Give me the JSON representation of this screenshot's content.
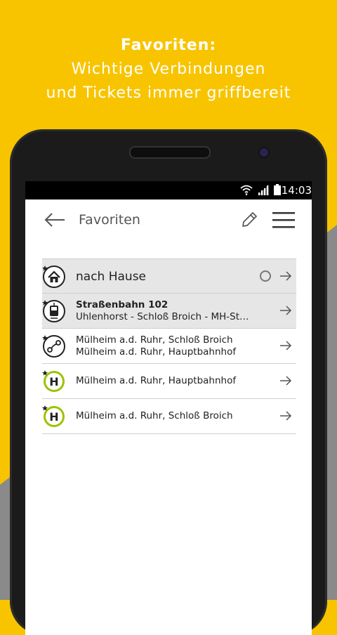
{
  "promo": {
    "heading": "Favoriten:",
    "line1": "Wichtige Verbindungen",
    "line2": "und Tickets immer griffbereit"
  },
  "statusbar": {
    "time": "14:03"
  },
  "appbar": {
    "title": "Favoriten"
  },
  "favorites": [
    {
      "type": "home",
      "title": "nach Hause",
      "highlighted": true,
      "has_radio": true
    },
    {
      "type": "tram",
      "title": "Straßenbahn 102",
      "subtitle": "Uhlenhorst - Schloß Broich - MH-Stadt...",
      "highlighted": true
    },
    {
      "type": "route",
      "from": "Mülheim a.d. Ruhr, Schloß Broich",
      "to": "Mülheim a.d. Ruhr, Hauptbahnhof"
    },
    {
      "type": "stop",
      "title": "Mülheim a.d. Ruhr, Hauptbahnhof"
    },
    {
      "type": "stop",
      "title": "Mülheim a.d. Ruhr, Schloß Broich"
    }
  ],
  "colors": {
    "brand_yellow": "#f8c400",
    "stop_green": "#9bc400"
  }
}
